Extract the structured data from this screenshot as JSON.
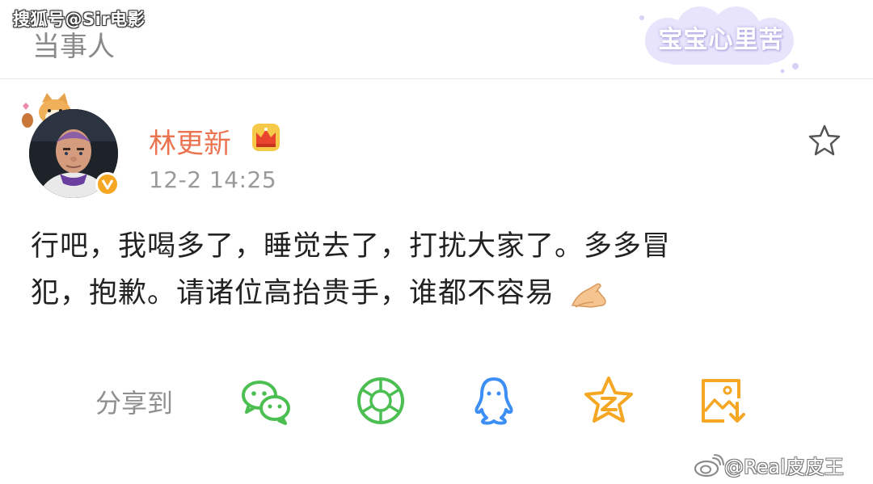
{
  "watermark_top": "搜狐号@Sir电影",
  "section_title": "当事人",
  "sticker_text": "宝宝心里苦",
  "post": {
    "username": "林更新",
    "timestamp": "12-2 14:25",
    "line1": "行吧，我喝多了，睡觉去了，打扰大家了。多多冒",
    "line2": "犯，抱歉。请诸位高抬贵手，谁都不容易"
  },
  "share": {
    "label": "分享到",
    "targets": [
      "wechat-icon",
      "moments-icon",
      "qq-icon",
      "qzone-icon",
      "save-image-icon"
    ]
  },
  "watermark_bottom": "@Real皮皮王",
  "colors": {
    "username": "#eb7350",
    "icon_green": "#4cbf52",
    "icon_blue": "#3d8ff5",
    "icon_orange": "#f5a623"
  }
}
